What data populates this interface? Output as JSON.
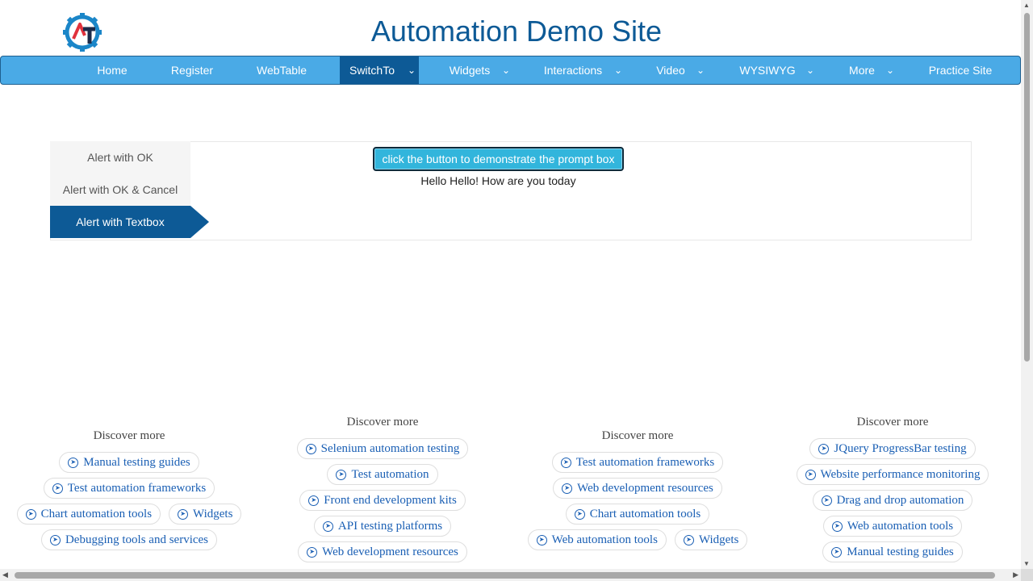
{
  "header": {
    "title": "Automation Demo Site"
  },
  "nav": {
    "items": [
      {
        "label": "Home"
      },
      {
        "label": "Register"
      },
      {
        "label": "WebTable"
      },
      {
        "label": "SwitchTo"
      },
      {
        "label": "Widgets"
      },
      {
        "label": "Interactions"
      },
      {
        "label": "Video"
      },
      {
        "label": "WYSIWYG"
      },
      {
        "label": "More"
      },
      {
        "label": "Practice Site"
      }
    ],
    "active": "SwitchTo"
  },
  "tabs": {
    "items": [
      {
        "label": "Alert with OK"
      },
      {
        "label": "Alert with OK & Cancel"
      },
      {
        "label": "Alert with Textbox"
      }
    ],
    "active": "Alert with Textbox"
  },
  "prompt": {
    "button_label": "click the button to demonstrate the prompt box",
    "result_text": "Hello Hello! How are you today"
  },
  "discover": {
    "columns": [
      {
        "title": "Discover more",
        "rows": [
          [
            "Manual testing guides"
          ],
          [
            "Test automation frameworks"
          ],
          [
            "Chart automation tools",
            "Widgets"
          ],
          [
            "Debugging tools and services"
          ]
        ]
      },
      {
        "title": "Discover more",
        "rows": [
          [
            "Selenium automation testing"
          ],
          [
            "Test automation"
          ],
          [
            "Front end development kits"
          ],
          [
            "API testing platforms"
          ],
          [
            "Web development resources"
          ]
        ]
      },
      {
        "title": "Discover more",
        "rows": [
          [
            "Test automation frameworks"
          ],
          [
            "Web development resources"
          ],
          [
            "Chart automation tools"
          ],
          [
            "Web automation tools",
            "Widgets"
          ]
        ]
      },
      {
        "title": "Discover more",
        "rows": [
          [
            "JQuery ProgressBar testing"
          ],
          [
            "Website performance monitoring"
          ],
          [
            "Drag and drop automation"
          ],
          [
            "Web automation tools"
          ],
          [
            "Manual testing guides"
          ]
        ]
      }
    ]
  },
  "colors": {
    "title": "#0d5a96",
    "nav_bg": "#4aaae6",
    "nav_active": "#0d5a96",
    "button_bg": "#32b5dc",
    "chip_text": "#1a5fb4"
  }
}
